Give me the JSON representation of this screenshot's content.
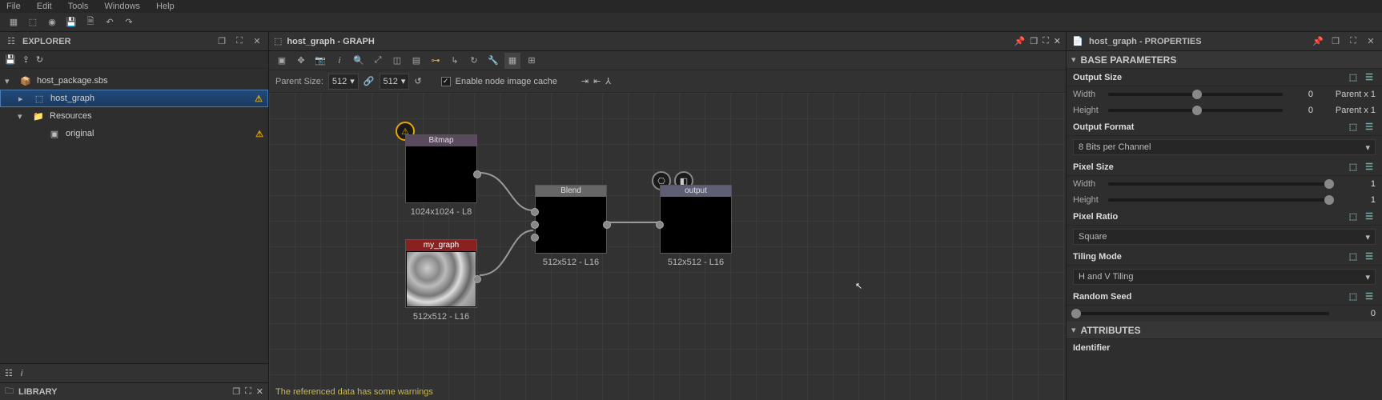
{
  "menubar": {
    "file": "File",
    "edit": "Edit",
    "tools": "Tools",
    "windows": "Windows",
    "help": "Help"
  },
  "explorer": {
    "title": "EXPLORER",
    "package": "host_package.sbs",
    "graph": "host_graph",
    "resources": "Resources",
    "original": "original",
    "library": "LIBRARY"
  },
  "graph": {
    "tab_title": "host_graph - GRAPH",
    "parent_size_label": "Parent Size:",
    "parent_w": "512",
    "parent_h": "512",
    "cache_label": "Enable node image cache",
    "status": "The referenced data has some warnings",
    "nodes": {
      "bitmap": {
        "title": "Bitmap",
        "caption": "1024x1024 - L8"
      },
      "mygraph": {
        "title": "my_graph",
        "caption": "512x512 - L16"
      },
      "blend": {
        "title": "Blend",
        "caption": "512x512 - L16"
      },
      "output": {
        "title": "output",
        "caption": "512x512 - L16"
      }
    }
  },
  "props": {
    "tab_title": "host_graph - PROPERTIES",
    "base_params": "BASE PARAMETERS",
    "attributes": "ATTRIBUTES",
    "output_size": "Output Size",
    "output_format": "Output Format",
    "pixel_size": "Pixel Size",
    "pixel_ratio": "Pixel Ratio",
    "tiling_mode": "Tiling Mode",
    "random_seed": "Random Seed",
    "identifier": "Identifier",
    "width": "Width",
    "height": "Height",
    "parentx1": "Parent x 1",
    "val0": "0",
    "val1": "1",
    "bits8": "8 Bits per Channel",
    "square": "Square",
    "hv_tiling": "H and V Tiling"
  }
}
